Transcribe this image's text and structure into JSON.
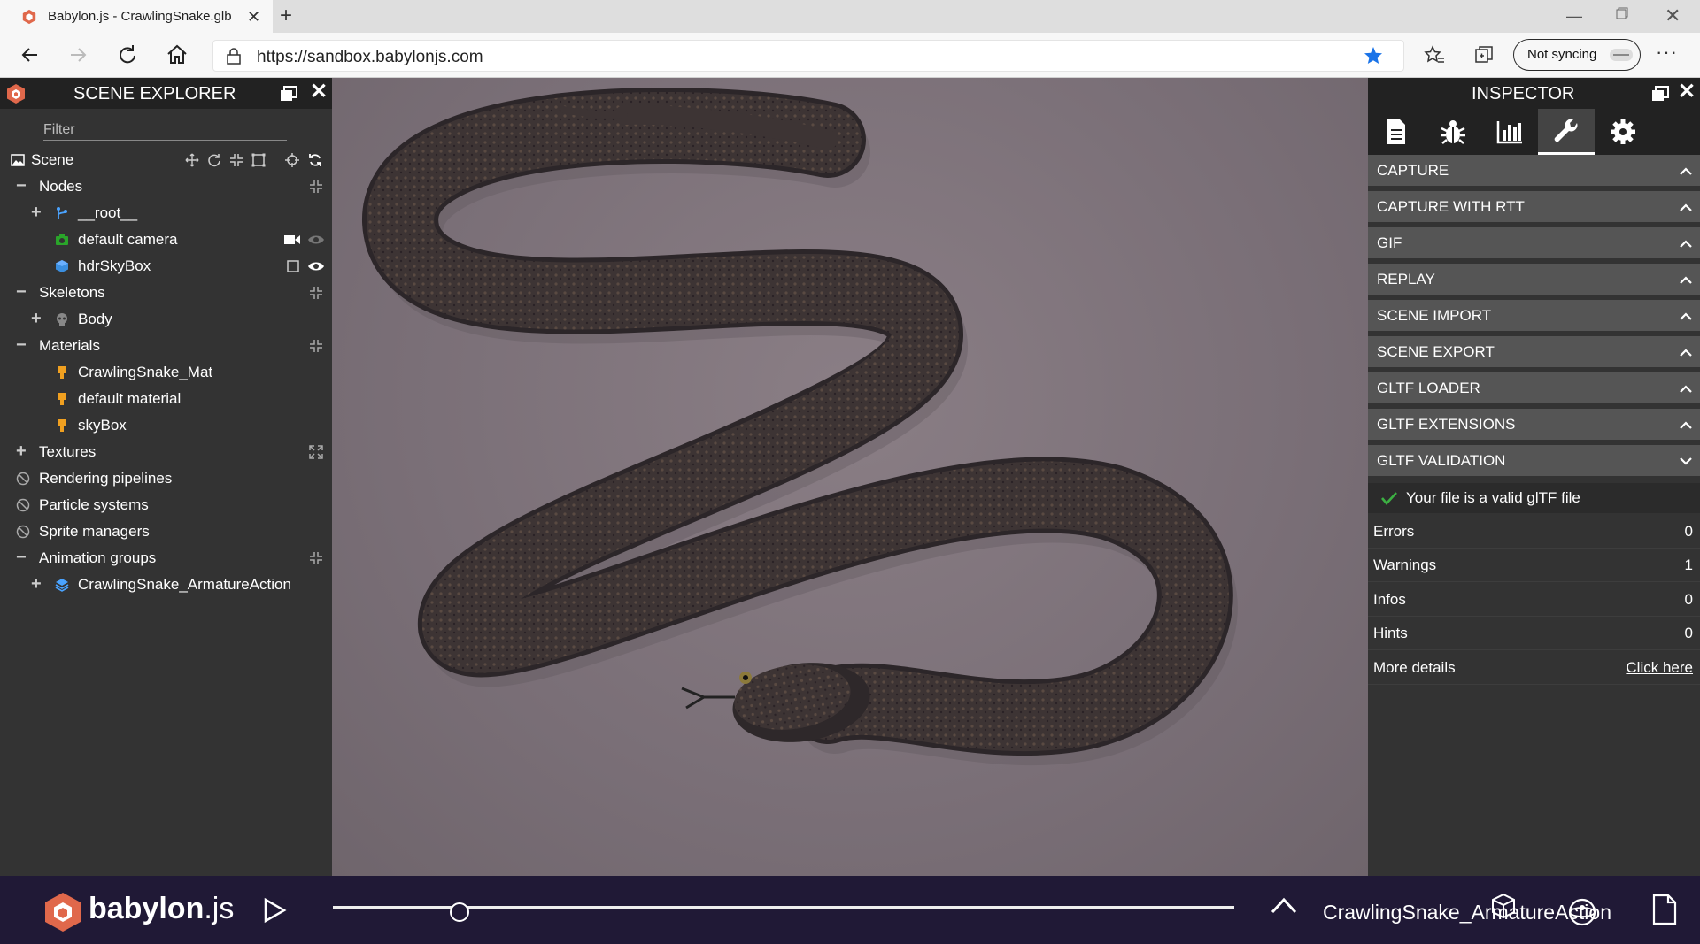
{
  "browser": {
    "tab_title": "Babylon.js - CrawlingSnake.glb",
    "url": "https://sandbox.babylonjs.com",
    "sync_label": "Not syncing"
  },
  "scene_explorer": {
    "title": "SCENE EXPLORER",
    "filter_placeholder": "Filter",
    "scene_label": "Scene",
    "nodes_label": "Nodes",
    "nodes": [
      "__root__",
      "default camera",
      "hdrSkyBox"
    ],
    "skeletons_label": "Skeletons",
    "skeletons": [
      "Body"
    ],
    "materials_label": "Materials",
    "materials": [
      "CrawlingSnake_Mat",
      "default material",
      "skyBox"
    ],
    "textures_label": "Textures",
    "rendering_pipelines_label": "Rendering pipelines",
    "particle_systems_label": "Particle systems",
    "sprite_managers_label": "Sprite managers",
    "animation_groups_label": "Animation groups",
    "animation_groups": [
      "CrawlingSnake_ArmatureAction"
    ]
  },
  "inspector": {
    "title": "INSPECTOR",
    "sections": [
      "CAPTURE",
      "CAPTURE WITH RTT",
      "GIF",
      "REPLAY",
      "SCENE IMPORT",
      "SCENE EXPORT",
      "GLTF LOADER",
      "GLTF EXTENSIONS",
      "GLTF VALIDATION"
    ],
    "validation_message": "Your file is a valid glTF file",
    "stats": [
      {
        "label": "Errors",
        "value": "0"
      },
      {
        "label": "Warnings",
        "value": "1"
      },
      {
        "label": "Infos",
        "value": "0"
      },
      {
        "label": "Hints",
        "value": "0"
      }
    ],
    "more_details_label": "More details",
    "more_details_link": "Click here"
  },
  "footer": {
    "logo_text": "babylon",
    "logo_suffix": ".js",
    "animation_name": "CrawlingSnake_ArmatureAction",
    "timeline_position": 0.14
  },
  "colors": {
    "panel_bg": "#333333",
    "header_bg": "#222222",
    "section_bg": "#555555",
    "footer_bg": "#201936",
    "valid_green": "#3cb043",
    "brand_red": "#e0684b"
  }
}
